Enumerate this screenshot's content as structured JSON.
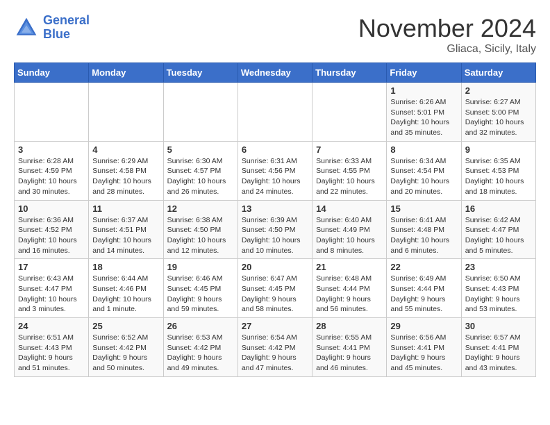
{
  "header": {
    "logo_line1": "General",
    "logo_line2": "Blue",
    "month": "November 2024",
    "location": "Gliaca, Sicily, Italy"
  },
  "days_of_week": [
    "Sunday",
    "Monday",
    "Tuesday",
    "Wednesday",
    "Thursday",
    "Friday",
    "Saturday"
  ],
  "weeks": [
    [
      {
        "day": "",
        "info": ""
      },
      {
        "day": "",
        "info": ""
      },
      {
        "day": "",
        "info": ""
      },
      {
        "day": "",
        "info": ""
      },
      {
        "day": "",
        "info": ""
      },
      {
        "day": "1",
        "info": "Sunrise: 6:26 AM\nSunset: 5:01 PM\nDaylight: 10 hours and 35 minutes."
      },
      {
        "day": "2",
        "info": "Sunrise: 6:27 AM\nSunset: 5:00 PM\nDaylight: 10 hours and 32 minutes."
      }
    ],
    [
      {
        "day": "3",
        "info": "Sunrise: 6:28 AM\nSunset: 4:59 PM\nDaylight: 10 hours and 30 minutes."
      },
      {
        "day": "4",
        "info": "Sunrise: 6:29 AM\nSunset: 4:58 PM\nDaylight: 10 hours and 28 minutes."
      },
      {
        "day": "5",
        "info": "Sunrise: 6:30 AM\nSunset: 4:57 PM\nDaylight: 10 hours and 26 minutes."
      },
      {
        "day": "6",
        "info": "Sunrise: 6:31 AM\nSunset: 4:56 PM\nDaylight: 10 hours and 24 minutes."
      },
      {
        "day": "7",
        "info": "Sunrise: 6:33 AM\nSunset: 4:55 PM\nDaylight: 10 hours and 22 minutes."
      },
      {
        "day": "8",
        "info": "Sunrise: 6:34 AM\nSunset: 4:54 PM\nDaylight: 10 hours and 20 minutes."
      },
      {
        "day": "9",
        "info": "Sunrise: 6:35 AM\nSunset: 4:53 PM\nDaylight: 10 hours and 18 minutes."
      }
    ],
    [
      {
        "day": "10",
        "info": "Sunrise: 6:36 AM\nSunset: 4:52 PM\nDaylight: 10 hours and 16 minutes."
      },
      {
        "day": "11",
        "info": "Sunrise: 6:37 AM\nSunset: 4:51 PM\nDaylight: 10 hours and 14 minutes."
      },
      {
        "day": "12",
        "info": "Sunrise: 6:38 AM\nSunset: 4:50 PM\nDaylight: 10 hours and 12 minutes."
      },
      {
        "day": "13",
        "info": "Sunrise: 6:39 AM\nSunset: 4:50 PM\nDaylight: 10 hours and 10 minutes."
      },
      {
        "day": "14",
        "info": "Sunrise: 6:40 AM\nSunset: 4:49 PM\nDaylight: 10 hours and 8 minutes."
      },
      {
        "day": "15",
        "info": "Sunrise: 6:41 AM\nSunset: 4:48 PM\nDaylight: 10 hours and 6 minutes."
      },
      {
        "day": "16",
        "info": "Sunrise: 6:42 AM\nSunset: 4:47 PM\nDaylight: 10 hours and 5 minutes."
      }
    ],
    [
      {
        "day": "17",
        "info": "Sunrise: 6:43 AM\nSunset: 4:47 PM\nDaylight: 10 hours and 3 minutes."
      },
      {
        "day": "18",
        "info": "Sunrise: 6:44 AM\nSunset: 4:46 PM\nDaylight: 10 hours and 1 minute."
      },
      {
        "day": "19",
        "info": "Sunrise: 6:46 AM\nSunset: 4:45 PM\nDaylight: 9 hours and 59 minutes."
      },
      {
        "day": "20",
        "info": "Sunrise: 6:47 AM\nSunset: 4:45 PM\nDaylight: 9 hours and 58 minutes."
      },
      {
        "day": "21",
        "info": "Sunrise: 6:48 AM\nSunset: 4:44 PM\nDaylight: 9 hours and 56 minutes."
      },
      {
        "day": "22",
        "info": "Sunrise: 6:49 AM\nSunset: 4:44 PM\nDaylight: 9 hours and 55 minutes."
      },
      {
        "day": "23",
        "info": "Sunrise: 6:50 AM\nSunset: 4:43 PM\nDaylight: 9 hours and 53 minutes."
      }
    ],
    [
      {
        "day": "24",
        "info": "Sunrise: 6:51 AM\nSunset: 4:43 PM\nDaylight: 9 hours and 51 minutes."
      },
      {
        "day": "25",
        "info": "Sunrise: 6:52 AM\nSunset: 4:42 PM\nDaylight: 9 hours and 50 minutes."
      },
      {
        "day": "26",
        "info": "Sunrise: 6:53 AM\nSunset: 4:42 PM\nDaylight: 9 hours and 49 minutes."
      },
      {
        "day": "27",
        "info": "Sunrise: 6:54 AM\nSunset: 4:42 PM\nDaylight: 9 hours and 47 minutes."
      },
      {
        "day": "28",
        "info": "Sunrise: 6:55 AM\nSunset: 4:41 PM\nDaylight: 9 hours and 46 minutes."
      },
      {
        "day": "29",
        "info": "Sunrise: 6:56 AM\nSunset: 4:41 PM\nDaylight: 9 hours and 45 minutes."
      },
      {
        "day": "30",
        "info": "Sunrise: 6:57 AM\nSunset: 4:41 PM\nDaylight: 9 hours and 43 minutes."
      }
    ]
  ]
}
